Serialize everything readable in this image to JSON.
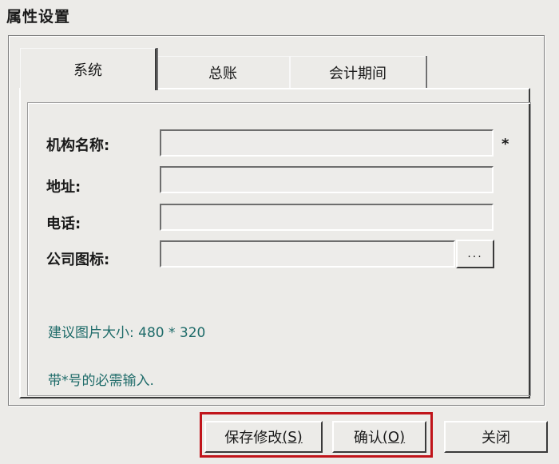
{
  "window": {
    "title": "属性设置"
  },
  "tabs": [
    {
      "label": "系统",
      "active": true
    },
    {
      "label": "总账",
      "active": false
    },
    {
      "label": "会计期间",
      "active": false
    }
  ],
  "form": {
    "org_name": {
      "label": "机构名称:",
      "value": "",
      "required_mark": "*"
    },
    "address": {
      "label": "地址:",
      "value": ""
    },
    "phone": {
      "label": "电话:",
      "value": ""
    },
    "logo": {
      "label": "公司图标:",
      "value": "",
      "browse_label": "..."
    }
  },
  "hints": {
    "image_size": "建议图片大小: 480 * 320",
    "required_note": "带*号的必需输入."
  },
  "buttons": {
    "save": {
      "label": "保存修改",
      "key": "(S)"
    },
    "confirm": {
      "label": "确认",
      "key": "(O)"
    },
    "close": {
      "label": "关闭"
    }
  },
  "colors": {
    "window_bg": "#ecebe8",
    "hint_text": "#1e6b69",
    "highlight_border": "#c0141a"
  }
}
